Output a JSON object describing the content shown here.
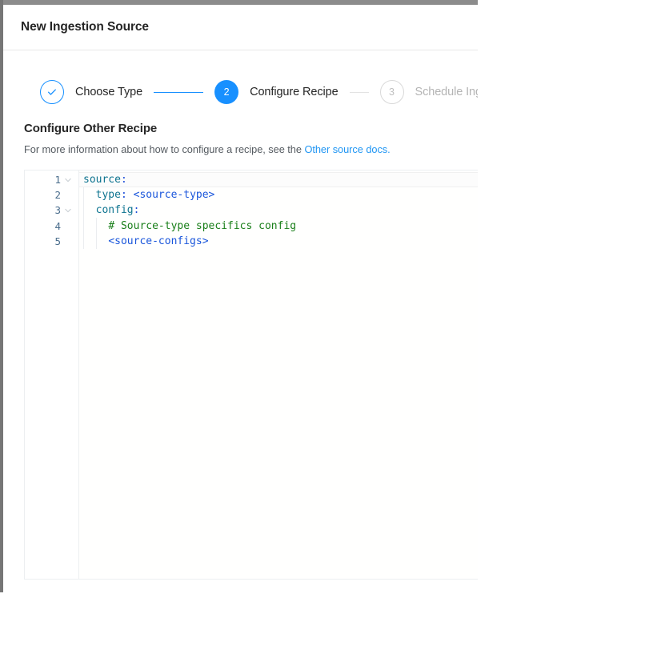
{
  "modal": {
    "title": "New Ingestion Source"
  },
  "stepper": {
    "steps": [
      {
        "id": "choose-type",
        "number": "1",
        "label": "Choose Type",
        "state": "done",
        "icon": "check-icon"
      },
      {
        "id": "configure-recipe",
        "number": "2",
        "label": "Configure Recipe",
        "state": "active"
      },
      {
        "id": "schedule-ingestion",
        "number": "3",
        "label": "Schedule Inges",
        "state": "wait"
      }
    ],
    "connectors": [
      {
        "id": "connector-1-2",
        "state": "active"
      },
      {
        "id": "connector-2-3",
        "state": "inactive"
      }
    ]
  },
  "section": {
    "title": "Configure Other Recipe",
    "description_prefix": "For more information about how to configure a recipe, see the ",
    "link_text": "Other source docs.",
    "link_color": "#2196f3"
  },
  "editor": {
    "language": "yaml",
    "active_line": 1,
    "lines": [
      {
        "number": "1",
        "foldable": true,
        "indent": 0,
        "tokens": [
          {
            "text": "source",
            "type": "key"
          },
          {
            "text": ":",
            "type": "punct"
          }
        ]
      },
      {
        "number": "2",
        "foldable": false,
        "indent": 1,
        "tokens": [
          {
            "text": "  ",
            "type": "plain"
          },
          {
            "text": "type",
            "type": "key"
          },
          {
            "text": ":",
            "type": "punct"
          },
          {
            "text": " ",
            "type": "plain"
          },
          {
            "text": "<source-type>",
            "type": "val"
          }
        ]
      },
      {
        "number": "3",
        "foldable": true,
        "indent": 1,
        "tokens": [
          {
            "text": "  ",
            "type": "plain"
          },
          {
            "text": "config",
            "type": "key"
          },
          {
            "text": ":",
            "type": "punct"
          }
        ]
      },
      {
        "number": "4",
        "foldable": false,
        "indent": 2,
        "tokens": [
          {
            "text": "    ",
            "type": "plain"
          },
          {
            "text": "# Source-type specifics config",
            "type": "comment"
          }
        ]
      },
      {
        "number": "5",
        "foldable": false,
        "indent": 2,
        "tokens": [
          {
            "text": "    ",
            "type": "plain"
          },
          {
            "text": "<source-configs>",
            "type": "val"
          }
        ]
      }
    ]
  },
  "colors": {
    "accent": "#1890ff",
    "link": "#2196f3",
    "text": "#262626",
    "muted": "#b4b4b4",
    "border": "#e8e8e8",
    "yaml_key": "#0e7490",
    "yaml_value": "#1a56db",
    "yaml_comment": "#1a7f1a",
    "gutter_number": "#4a6d8c"
  }
}
